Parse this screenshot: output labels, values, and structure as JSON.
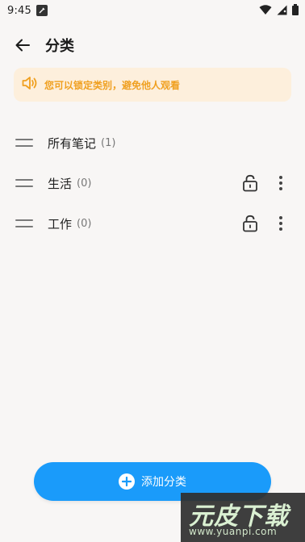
{
  "status": {
    "time": "9:45"
  },
  "header": {
    "title": "分类"
  },
  "notice": {
    "text": "您可以锁定类别，避免他人观看"
  },
  "categories": [
    {
      "name": "所有笔记",
      "count": "(1)",
      "lockable": false
    },
    {
      "name": "生活",
      "count": "(0)",
      "lockable": true
    },
    {
      "name": "工作",
      "count": "(0)",
      "lockable": true
    }
  ],
  "add_button": {
    "label": "添加分类"
  },
  "watermark": {
    "title": "元皮下载",
    "url": "www.yuanpi.com"
  },
  "colors": {
    "accent": "#1a9bfa",
    "notice_bg": "#fdefdc",
    "notice_text": "#f0a020",
    "background": "#f8f6f5"
  }
}
